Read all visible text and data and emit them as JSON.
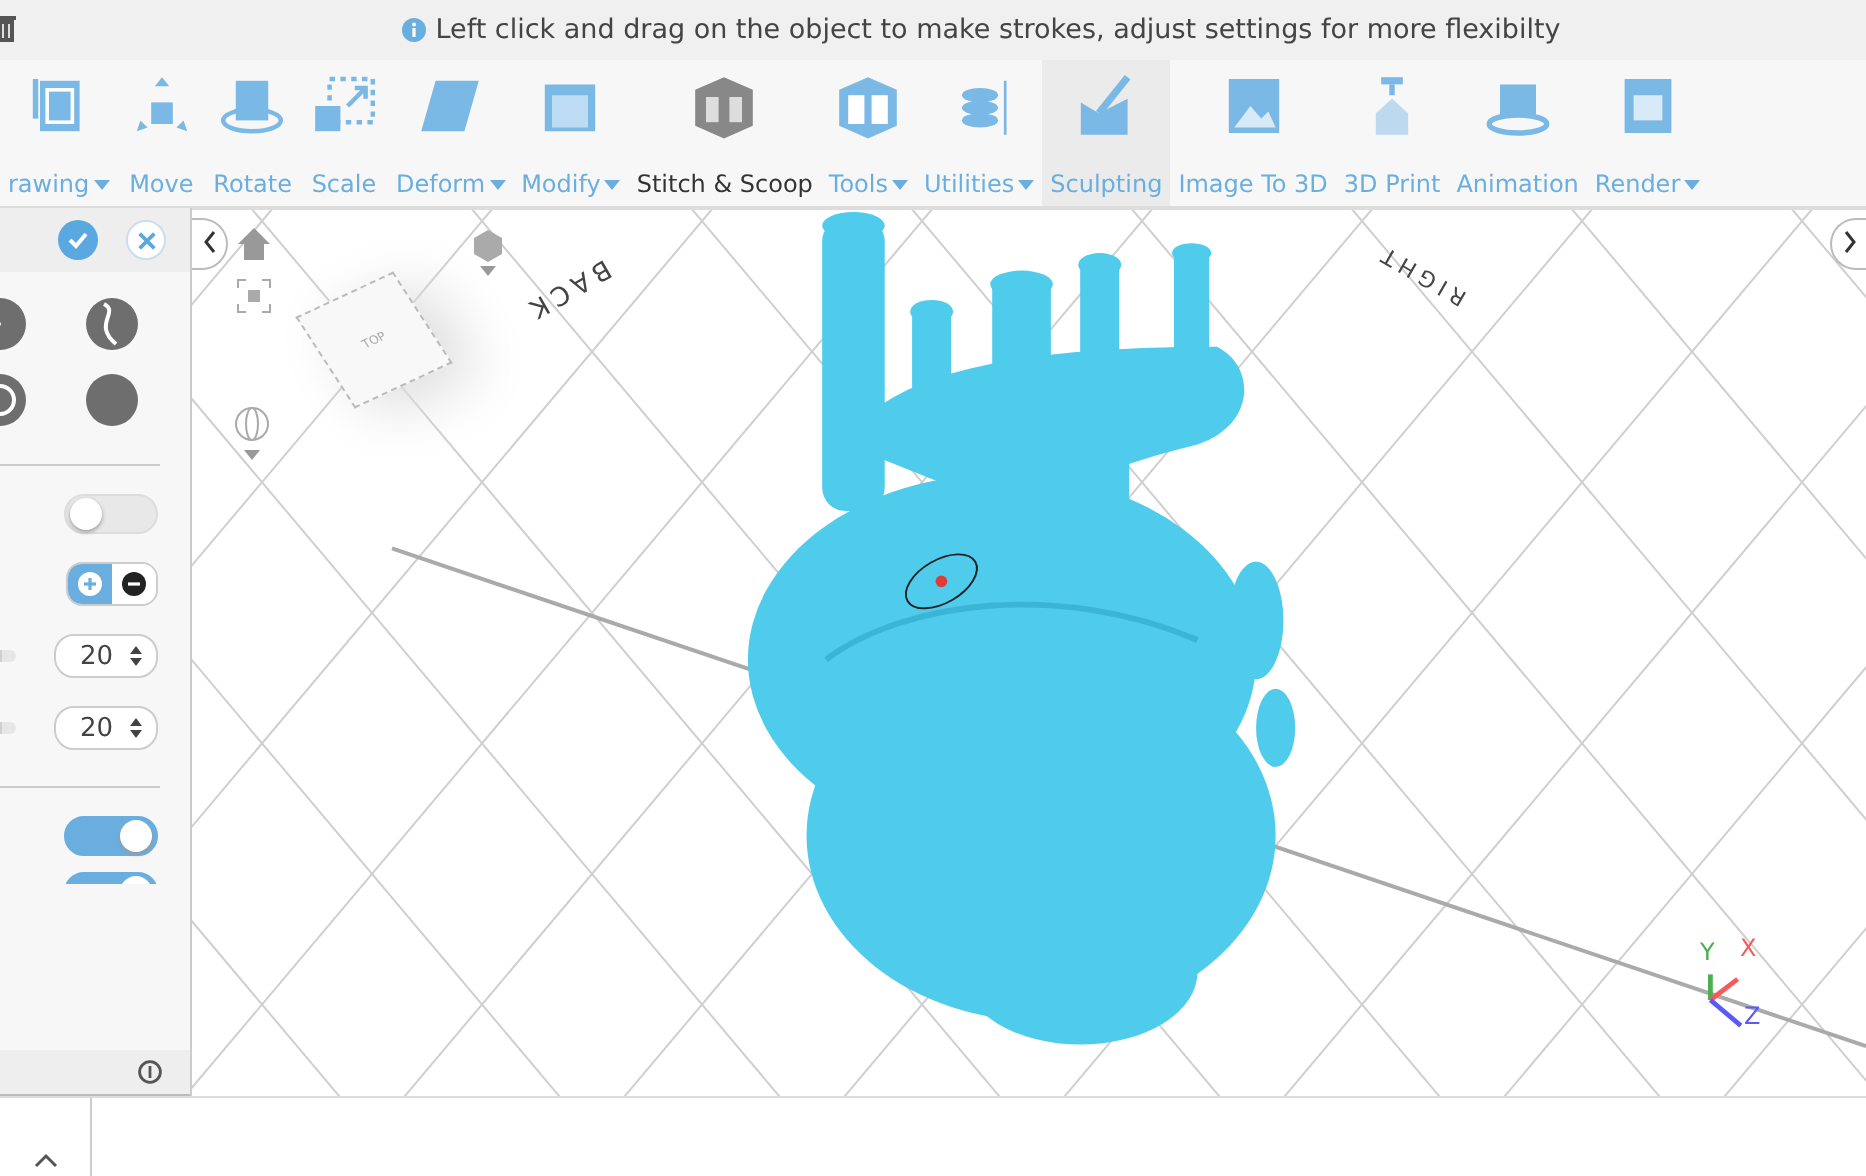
{
  "hint_bar": {
    "text": "Left click and drag on the object to make strokes, adjust settings for more flexibilty"
  },
  "toolbar": [
    {
      "kind": "drawing",
      "label": "rawing",
      "dropdown": true,
      "selected": false,
      "emphasized": false
    },
    {
      "kind": "move",
      "label": "Move",
      "dropdown": false,
      "selected": false,
      "emphasized": false
    },
    {
      "kind": "rotate",
      "label": "Rotate",
      "dropdown": false,
      "selected": false,
      "emphasized": false
    },
    {
      "kind": "scale",
      "label": "Scale",
      "dropdown": false,
      "selected": false,
      "emphasized": false
    },
    {
      "kind": "deform",
      "label": "Deform",
      "dropdown": true,
      "selected": false,
      "emphasized": false
    },
    {
      "kind": "modify",
      "label": "Modify",
      "dropdown": true,
      "selected": false,
      "emphasized": false
    },
    {
      "kind": "stitch",
      "label": "Stitch & Scoop",
      "dropdown": false,
      "selected": false,
      "emphasized": true
    },
    {
      "kind": "tools",
      "label": "Tools",
      "dropdown": true,
      "selected": false,
      "emphasized": false
    },
    {
      "kind": "utilities",
      "label": "Utilities",
      "dropdown": true,
      "selected": false,
      "emphasized": false
    },
    {
      "kind": "sculpting",
      "label": "Sculpting",
      "dropdown": false,
      "selected": true,
      "emphasized": false
    },
    {
      "kind": "image",
      "label": "Image To 3D",
      "dropdown": false,
      "selected": false,
      "emphasized": false
    },
    {
      "kind": "print",
      "label": "3D Print",
      "dropdown": false,
      "selected": false,
      "emphasized": false
    },
    {
      "kind": "animation",
      "label": "Animation",
      "dropdown": false,
      "selected": false,
      "emphasized": false
    },
    {
      "kind": "render",
      "label": "Render",
      "dropdown": true,
      "selected": false,
      "emphasized": false
    }
  ],
  "panel": {
    "brushes": [
      {
        "selected": false
      },
      {
        "selected": false
      },
      {
        "selected": false
      },
      {
        "selected": false
      }
    ],
    "symmetry_toggle": {
      "on": false
    },
    "mode": [
      {
        "kind": "add",
        "selected": true
      },
      {
        "kind": "subtract",
        "selected": false
      }
    ],
    "fields": [
      {
        "value": "20",
        "level": 0.1
      },
      {
        "value": "20",
        "level": 0.1
      }
    ],
    "toggles": [
      {
        "on": true
      },
      {
        "on": true
      }
    ]
  },
  "viewport": {
    "cube_label": "TOP",
    "back_label": "BACK",
    "right_label": "RIGHT",
    "axes": [
      {
        "label": "Y",
        "color": "#4caf50"
      },
      {
        "label": "X",
        "color": "#f45b5b"
      },
      {
        "label": "Z",
        "color": "#5b5bf4"
      }
    ]
  }
}
